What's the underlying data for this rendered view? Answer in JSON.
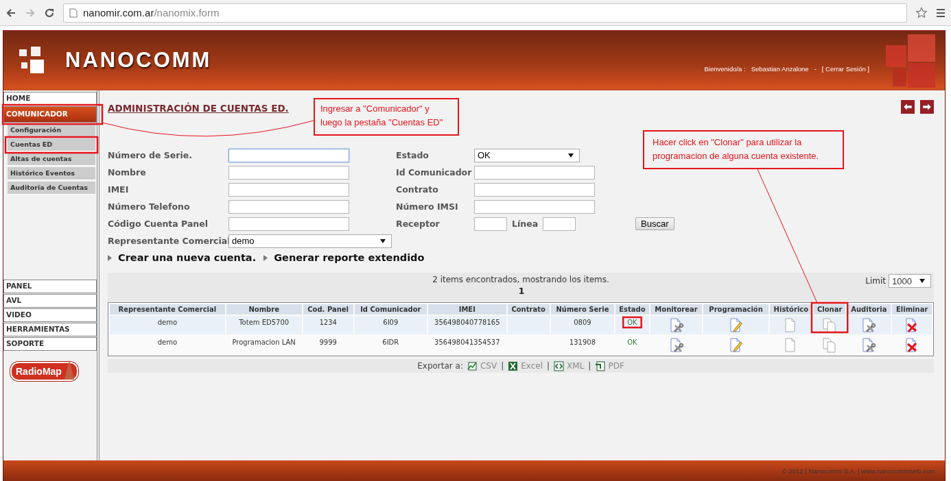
{
  "browser": {
    "url_host": "nanomir.com.ar",
    "url_path": "/nanomix.form"
  },
  "header": {
    "brand": "NANOCOMM",
    "welcome": "Bienvenido/a :",
    "user": "Sebastian Anzalone",
    "separator": "-",
    "logout": "[ Cerrar Sesión ]"
  },
  "sidebar": {
    "items": [
      {
        "label": "HOME",
        "selected": false,
        "highlighted": false
      },
      {
        "label": "COMUNICADOR",
        "selected": true,
        "highlighted": true,
        "children": [
          {
            "label": "Configuración",
            "highlighted": false
          },
          {
            "label": "Cuentas ED",
            "highlighted": true
          },
          {
            "label": "Altas de cuentas",
            "highlighted": false
          },
          {
            "label": "Histórico Eventos",
            "highlighted": false
          },
          {
            "label": "Auditoria de Cuentas",
            "highlighted": false
          }
        ]
      },
      {
        "label": "PANEL",
        "selected": false,
        "highlighted": false
      },
      {
        "label": "AVL",
        "selected": false,
        "highlighted": false
      },
      {
        "label": "VIDEO",
        "selected": false,
        "highlighted": false
      },
      {
        "label": "HERRAMIENTAS",
        "selected": false,
        "highlighted": false
      },
      {
        "label": "SOPORTE",
        "selected": false,
        "highlighted": false
      }
    ],
    "logo": "RadioMap"
  },
  "page_title": "ADMINISTRACIÓN DE CUENTAS ED.",
  "form": {
    "left": [
      {
        "label": "Número de Serie.",
        "kind": "text",
        "focused": true
      },
      {
        "label": "Nombre",
        "kind": "text",
        "focused": false
      },
      {
        "label": "IMEI",
        "kind": "text",
        "focused": false
      },
      {
        "label": "Número Telefono",
        "kind": "text",
        "focused": false
      },
      {
        "label": "Código Cuenta Panel",
        "kind": "text",
        "focused": false
      },
      {
        "label": "Representante Comercial",
        "kind": "select",
        "value": "demo"
      }
    ],
    "right": [
      {
        "label": "Estado",
        "kind": "select",
        "value": "OK"
      },
      {
        "label": "Id Comunicador",
        "kind": "text",
        "focused": false
      },
      {
        "label": "Contrato",
        "kind": "text",
        "focused": false
      },
      {
        "label": "Número IMSI",
        "kind": "text",
        "focused": false
      },
      {
        "label": "Receptor",
        "kind": "pair",
        "second_label": "Línea",
        "button": "Buscar"
      }
    ],
    "links": [
      "Crear una nueva cuenta.",
      "Generar reporte extendido"
    ]
  },
  "results": {
    "summary": "2 items encontrados, mostrando los items.",
    "page": "1",
    "limit_label": "Limit",
    "limit_value": "1000"
  },
  "table": {
    "columns": [
      {
        "label": "Representante Comercial",
        "kind": "text",
        "highlighted": false
      },
      {
        "label": "Nombre",
        "kind": "text",
        "highlighted": false
      },
      {
        "label": "Cod. Panel",
        "kind": "text",
        "highlighted": false
      },
      {
        "label": "Id Comunicador",
        "kind": "text",
        "highlighted": false
      },
      {
        "label": "IMEI",
        "kind": "text",
        "highlighted": false
      },
      {
        "label": "Contrato",
        "kind": "text",
        "highlighted": false
      },
      {
        "label": "Número Serie",
        "kind": "text",
        "highlighted": false
      },
      {
        "label": "Estado",
        "kind": "status",
        "highlighted": false
      },
      {
        "label": "Monitorear",
        "kind": "monitor",
        "highlighted": false
      },
      {
        "label": "Programación",
        "kind": "edit",
        "highlighted": false
      },
      {
        "label": "Histórico",
        "kind": "history",
        "highlighted": false
      },
      {
        "label": "Clonar",
        "kind": "clone",
        "highlighted": true
      },
      {
        "label": "Auditoria",
        "kind": "audit",
        "highlighted": false
      },
      {
        "label": "Eliminar",
        "kind": "delete",
        "highlighted": false
      }
    ],
    "rows": [
      {
        "cells": [
          "demo",
          "Totem ED5700",
          "1234",
          "6I09",
          "356498040778165",
          null,
          "0809",
          "OK"
        ],
        "status_highlighted": true
      },
      {
        "cells": [
          "demo",
          "Programacion LAN",
          "9999",
          "6IDR",
          "356498041354537",
          null,
          "131908",
          "OK"
        ],
        "status_highlighted": false
      }
    ]
  },
  "export": {
    "label": "Exportar a:",
    "separator": "|",
    "formats": [
      {
        "label": "CSV",
        "kind": "csv"
      },
      {
        "label": "Excel",
        "kind": "excel"
      },
      {
        "label": "XML",
        "kind": "xml"
      },
      {
        "label": "PDF",
        "kind": "pdf"
      }
    ]
  },
  "footer": "© 2012 | Nanocomm S.A. | www.nanocommweb.com",
  "callouts": [
    {
      "text": "Ingresar a \"Comunicador\" y luego la pestaña \"Cuentas ED\"",
      "kind": "sidebar"
    },
    {
      "text": "Hacer click en \"Clonar\" para utilizar la programacion de alguna cuenta existente.",
      "kind": "column"
    }
  ]
}
